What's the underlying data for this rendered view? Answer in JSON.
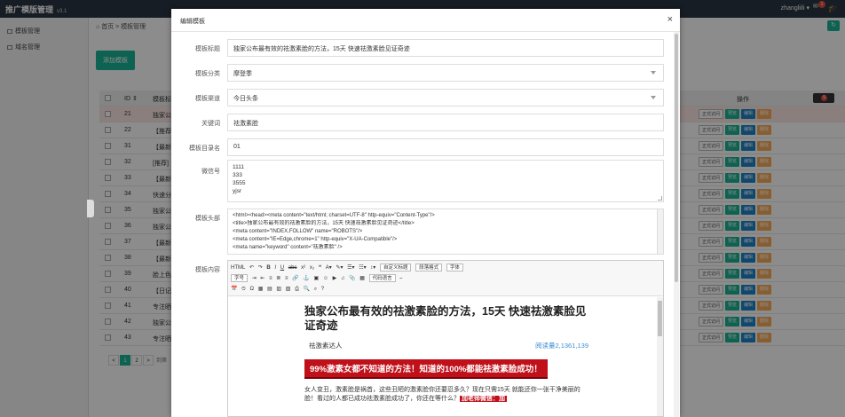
{
  "app": {
    "title": "推广模版管理",
    "version": "v3.1",
    "user": "zhangliili",
    "notification_count": "1"
  },
  "sidebar": {
    "items": [
      {
        "label": "模板管理"
      },
      {
        "label": "域名管理"
      }
    ]
  },
  "main": {
    "breadcrumb": {
      "home": "首页",
      "sep": ">",
      "current": "模板管理"
    },
    "add_button": "添加模板",
    "columns": {
      "id": "ID",
      "title": "模板标",
      "ops": "操作"
    },
    "rows": [
      {
        "id": "21",
        "title": "独家公"
      },
      {
        "id": "22",
        "title": "【推荐"
      },
      {
        "id": "31",
        "title": "【最新"
      },
      {
        "id": "32",
        "title": "[推荐]"
      },
      {
        "id": "33",
        "title": "【最新"
      },
      {
        "id": "34",
        "title": "快速分"
      },
      {
        "id": "35",
        "title": "独家公"
      },
      {
        "id": "36",
        "title": "独家公"
      },
      {
        "id": "37",
        "title": "【最新"
      },
      {
        "id": "38",
        "title": "【最新"
      },
      {
        "id": "39",
        "title": "脸上色"
      },
      {
        "id": "40",
        "title": "【日记"
      },
      {
        "id": "41",
        "title": "专注晒"
      },
      {
        "id": "42",
        "title": "独家公"
      },
      {
        "id": "43",
        "title": "专注晒"
      }
    ],
    "op_labels": {
      "visit": "正式访问",
      "preview": "预览",
      "edit": "编辑",
      "delete": "删除"
    },
    "pager": {
      "page1": "1",
      "page2": "2",
      "next": ">",
      "goto": "到第"
    }
  },
  "modal": {
    "title": "编辑模板",
    "close": "×",
    "fields": {
      "title_label": "模板标题",
      "title_value": "独家公布最有效的祛激素脸的方法，15天 快速祛激素脸见证奇迹",
      "category_label": "模板分类",
      "category_value": "摩登季",
      "channel_label": "模板渠道",
      "channel_value": "今日头条",
      "keyword_label": "关键词",
      "keyword_value": "祛激素脸",
      "dir_label": "模板目录名",
      "dir_value": "01",
      "wechat_label": "微信号",
      "wechat_lines": [
        "1111",
        "333",
        "3555",
        "yjsr"
      ],
      "head_label": "模板头部",
      "head_lines": [
        "    <html><head><meta content=\"text/html; charset=UTF-8\" http-equiv=\"Content-Type\"/>",
        "<title>独家公布最有效的祛激素脸的方法，15天 快速祛激素脸见证奇迹</title>",
        "<meta content=\"INDEX,FOLLOW\" name=\"ROBOTS\"/>",
        "<meta content=\"IE=Edge,chrome=1\" http-equiv=\"X-UA-Compatible\"/>",
        "<meta name=\"keyword\" content=\"祛激素脸\" />"
      ],
      "content_label": "模板内容"
    },
    "editor": {
      "html_btn": "HTML",
      "custom_title": "自定义标题",
      "para_format": "段落格式",
      "font_family": "字体",
      "font_size": "字号",
      "code_lang": "代码语言"
    },
    "article": {
      "title": "独家公布最有效的祛激素脸的方法，15天 快速祛激素脸见证奇迹",
      "author": "祛激素达人",
      "read_count": "阅读量2,1361,139",
      "banner": "99%激素女都不知道的方法！知道的100%都能祛激素脸成功！",
      "para": "女人变丑，激素脸是祸首，这些丑陋的激素脸你还要忍多久？现在只需15天 就能还你一张干净美丽的脸！看过的人都已成功祛激素脸成功了，你还在等什么？",
      "red_tag": "加老师微信：加"
    }
  }
}
